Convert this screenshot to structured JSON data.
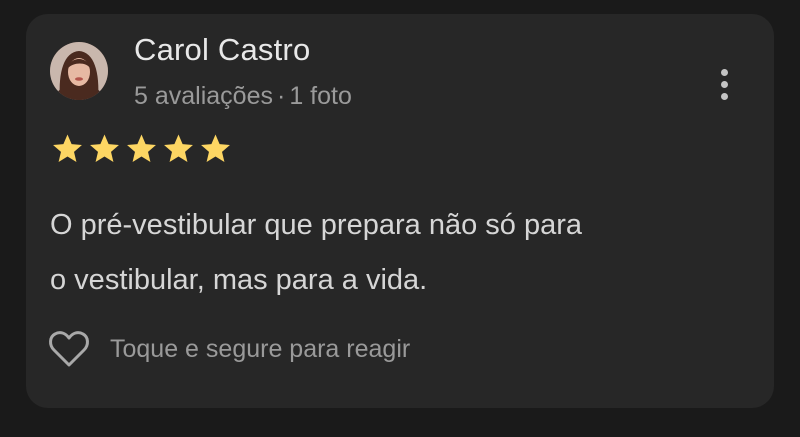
{
  "review": {
    "author_name": "Carol Castro",
    "review_count": "5 avaliações",
    "separator": "·",
    "photo_count": "1 foto",
    "rating": 5,
    "text_line1": "O pré-vestibular que prepara não só para",
    "text_line2": "o vestibular, mas para a vida.",
    "react_label": "Toque e segure para reagir"
  },
  "icons": {
    "avatar": "user-avatar",
    "more": "more-vert-icon",
    "star": "star-icon",
    "react": "heart-outline-icon"
  },
  "colors": {
    "background": "#1a1a1a",
    "card": "#272727",
    "star": "#fdd663",
    "primary_text": "#e8e8e8",
    "secondary_text": "#9a9a9a"
  }
}
